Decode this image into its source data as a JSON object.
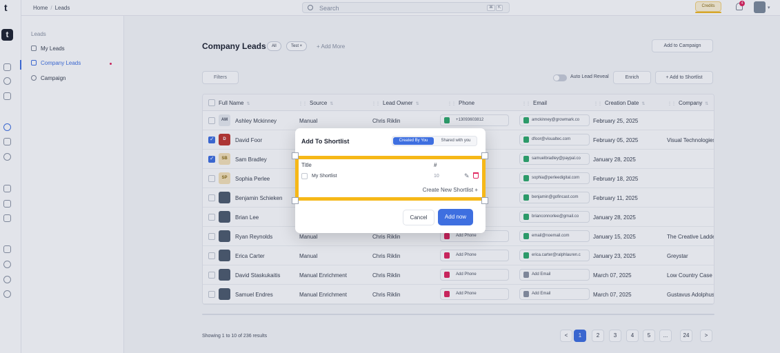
{
  "topbar": {
    "logo": "t",
    "breadcrumb": [
      "Home",
      "Leads"
    ],
    "search_placeholder": "Search",
    "shortcut_keys": [
      "⌘",
      "K"
    ],
    "credits_label": "Credits",
    "notification_count": "4"
  },
  "rail": {
    "logo": "t"
  },
  "sidebar": {
    "section": "Leads",
    "items": [
      {
        "label": "My Leads"
      },
      {
        "label": "Company Leads"
      },
      {
        "label": "Campaign"
      }
    ]
  },
  "header": {
    "title": "Company Leads",
    "chips": [
      "All",
      "Test  ×"
    ],
    "add_more": "+  Add More",
    "add_to_campaign": "Add to Campaign"
  },
  "toolbar": {
    "filters": "Filters",
    "auto_lead_reveal": "Auto Lead Reveal",
    "enrich": "Enrich",
    "add_to_shortlist": "+  Add to Shortlist"
  },
  "table": {
    "columns": [
      "Full Name",
      "Source",
      "Lead Owner",
      "Phone",
      "Email",
      "Creation Date",
      "Company"
    ],
    "rows": [
      {
        "initials": "AM",
        "name": "Ashley Mckinney",
        "source": "Manual",
        "owner": "Chris Riklin",
        "phone": "+13093603812",
        "email": "amckinney@growmark.co",
        "date": "February 25, 2025",
        "company": "",
        "checked": false
      },
      {
        "initials": "D",
        "name": "David Foor",
        "source": "",
        "owner": "",
        "phone": "",
        "email": "dfoor@visualtec.com",
        "date": "February 05, 2025",
        "company": "Visual Technologies",
        "checked": true
      },
      {
        "initials": "SB",
        "name": "Sam Bradley",
        "source": "",
        "owner": "",
        "phone": "",
        "email": "samuelbradley@paypal.co",
        "date": "January 28, 2025",
        "company": "",
        "checked": true
      },
      {
        "initials": "SP",
        "name": "Sophia Perlee",
        "source": "",
        "owner": "",
        "phone": "",
        "email": "sophia@perleedigital.com",
        "date": "February 18, 2025",
        "company": "",
        "checked": false
      },
      {
        "initials": "",
        "name": "Benjamin Schieken",
        "source": "",
        "owner": "",
        "phone": "",
        "email": "benjamin@gofincast.com",
        "date": "February 11, 2025",
        "company": "",
        "checked": false
      },
      {
        "initials": "",
        "name": "Brian Lee",
        "source": "",
        "owner": "",
        "phone": "",
        "email": "brianconnorlee@gmail.co",
        "date": "January 28, 2025",
        "company": "",
        "checked": false
      },
      {
        "initials": "",
        "name": "Ryan Reynolds",
        "source": "Manual",
        "owner": "Chris Riklin",
        "phone": "Add Phone",
        "email": "email@noemail.com",
        "date": "January 15, 2025",
        "company": "The Creative Ladder",
        "checked": false
      },
      {
        "initials": "",
        "name": "Erica Carter",
        "source": "Manual",
        "owner": "Chris Riklin",
        "phone": "Add Phone",
        "email": "erica.carter@ralphlauren.c",
        "date": "January 23, 2025",
        "company": "Greystar",
        "checked": false
      },
      {
        "initials": "",
        "name": "David Staskukaitis",
        "source": "Manual Enrichment",
        "owner": "Chris Riklin",
        "phone": "Add Phone",
        "email": "Add Email",
        "date": "March 07, 2025",
        "company": "Low Country Case",
        "checked": false
      },
      {
        "initials": "",
        "name": "Samuel Endres",
        "source": "Manual Enrichment",
        "owner": "Chris Riklin",
        "phone": "Add Phone",
        "email": "Add Email",
        "date": "March 07, 2025",
        "company": "Gustavus Adolphus",
        "checked": false
      }
    ]
  },
  "footer": {
    "showing": "Showing 1 to 10 of 236 results",
    "pages": [
      "<",
      "1",
      "2",
      "3",
      "4",
      "5",
      "...",
      "24",
      ">"
    ],
    "current_page": "1"
  },
  "modal": {
    "title": "Add To Shortlist",
    "tab_active": "Created By You",
    "tab_inactive": "Shared with you",
    "col_title": "Title",
    "col_count": "#",
    "shortlists": [
      {
        "name": "My Shortlist",
        "count": "10"
      }
    ],
    "create_new": "Create New Shortlist  +",
    "cancel": "Cancel",
    "confirm": "Add now"
  },
  "colors": {
    "primary": "#3e6fe0",
    "highlight": "#f6b818",
    "danger": "#e0245e",
    "success": "#2eaa6b"
  }
}
